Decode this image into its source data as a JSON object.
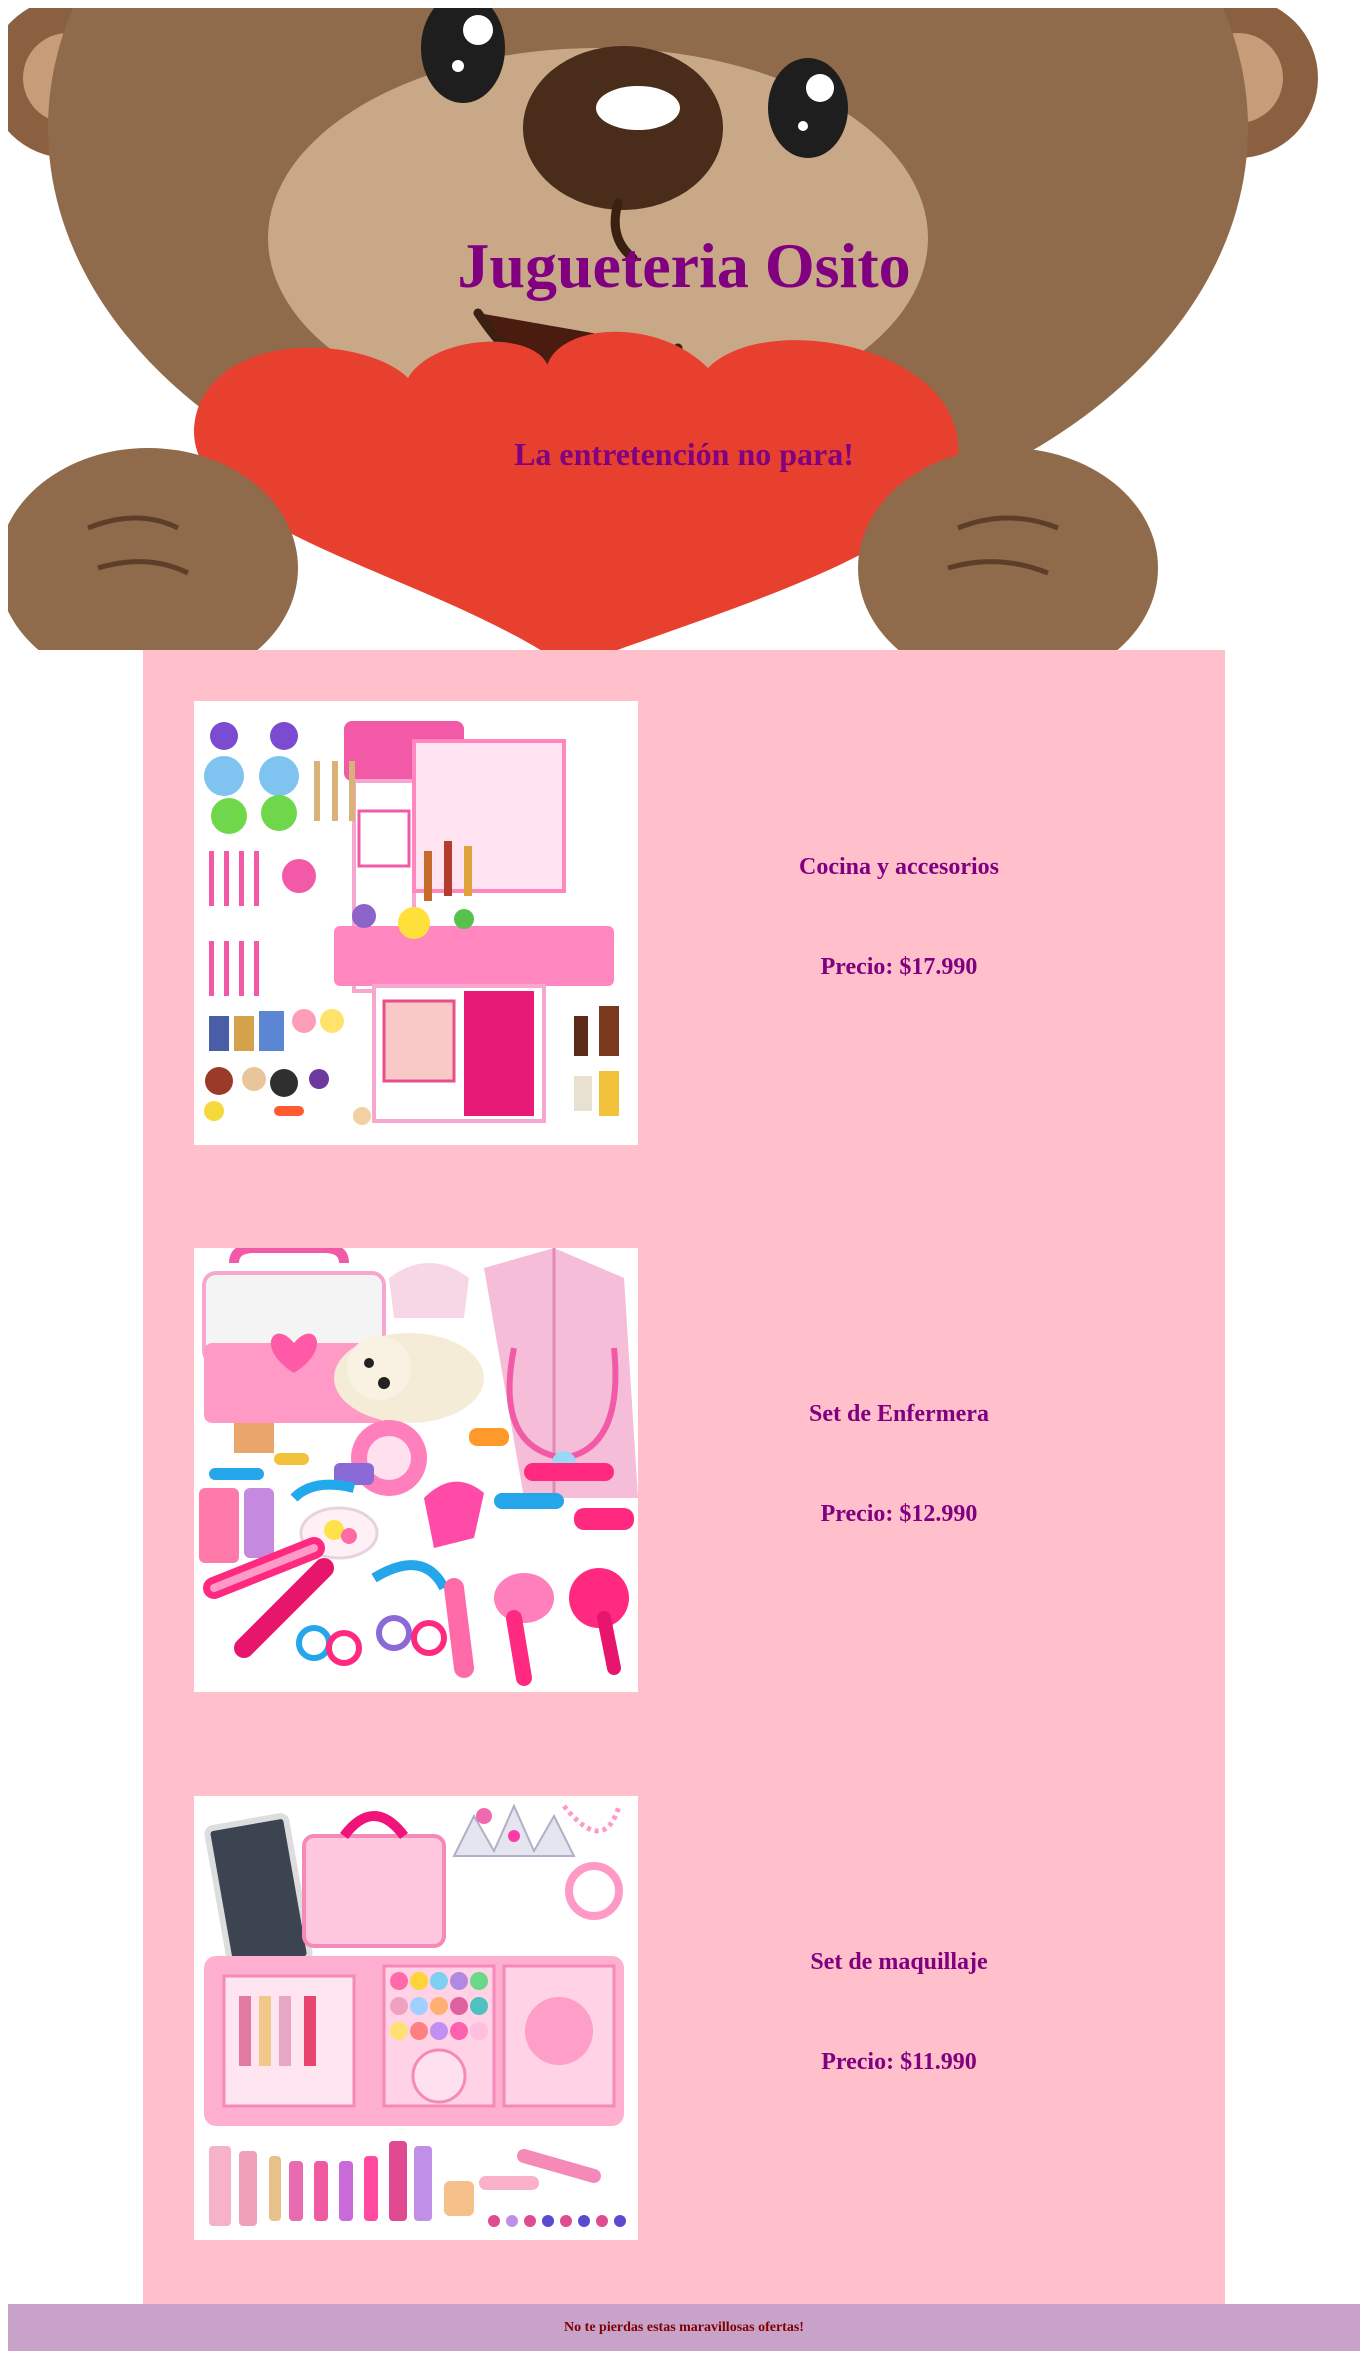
{
  "header": {
    "title": "Jugueteria Osito",
    "subtitle": "La entretención no para!"
  },
  "products": [
    {
      "name": "Cocina y accesorios",
      "price": "Precio: $17.990"
    },
    {
      "name": "Set de Enfermera",
      "price": "Precio: $12.990"
    },
    {
      "name": "Set de maquillaje",
      "price": "Precio: $11.990"
    }
  ],
  "footer": {
    "text": "No te pierdas estas maravillosas ofertas!"
  },
  "colors": {
    "heading": "#800080",
    "main_background": "#ffc0cb",
    "footer_background": "#c8a2c8",
    "footer_text": "#800000"
  }
}
